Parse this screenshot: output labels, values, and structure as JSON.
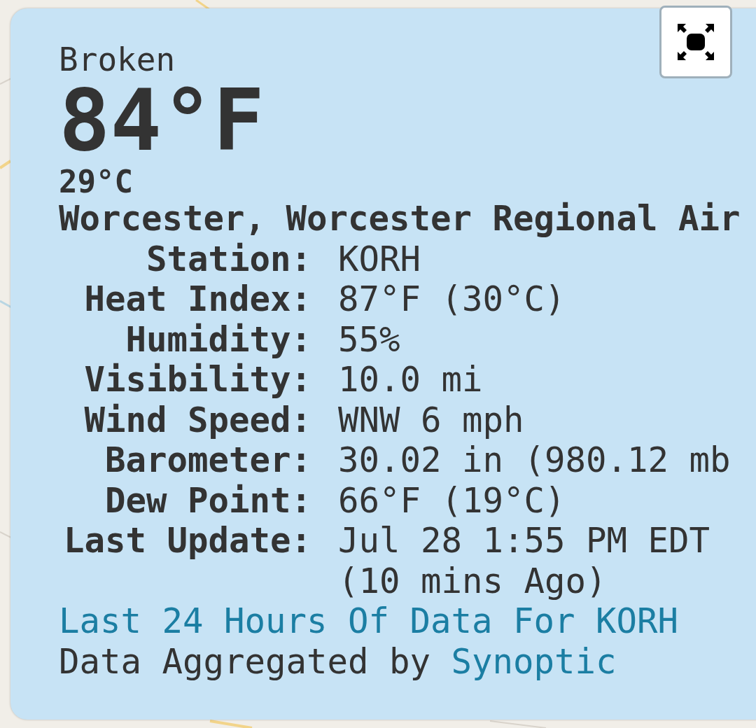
{
  "conditions": "Broken",
  "temperature_f": "84°F",
  "temperature_c": "29°C",
  "location": "Worcester, Worcester Regional Air",
  "details": [
    {
      "label": "Station:",
      "value": "KORH"
    },
    {
      "label": "Heat Index:",
      "value": "87°F (30°C)"
    },
    {
      "label": "Humidity:",
      "value": "55%"
    },
    {
      "label": "Visibility:",
      "value": "10.0 mi"
    },
    {
      "label": "Wind Speed:",
      "value": "WNW 6 mph"
    },
    {
      "label": "Barometer:",
      "value": "30.02 in (980.12 mb"
    },
    {
      "label": "Dew Point:",
      "value": "66°F (19°C)"
    },
    {
      "label": "Last Update:",
      "value": "Jul 28 1:55 PM EDT (10 mins Ago)"
    }
  ],
  "history_link": "Last 24 Hours Of Data For KORH",
  "credit": {
    "text": "Data Aggregated by",
    "link": "Synoptic"
  }
}
